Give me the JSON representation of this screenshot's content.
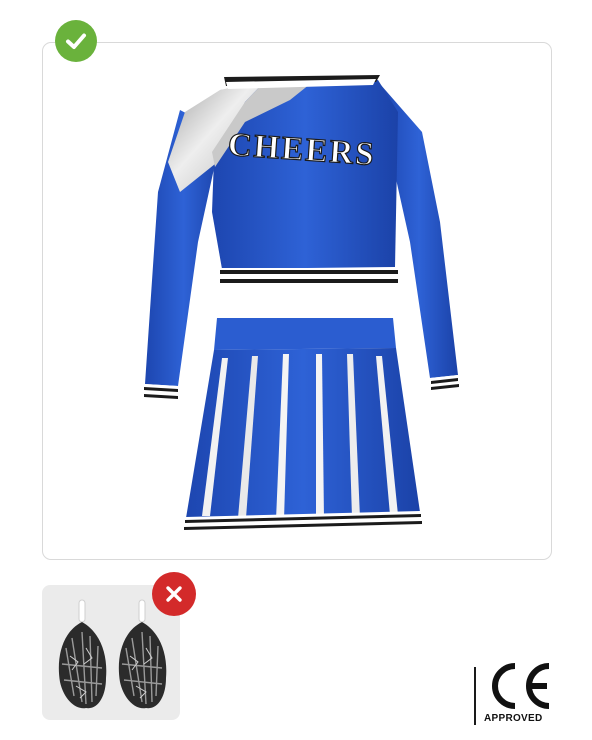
{
  "product": {
    "jersey_text": "CHEERS",
    "main_color": "#2a58c9",
    "accent_color": "#c8c8c8",
    "trim_color": "#1b1b1b"
  },
  "badges": {
    "included_icon": "checkmark-icon",
    "included_color": "#6ab23c",
    "excluded_icon": "close-icon",
    "excluded_color": "#d32a2a"
  },
  "certification": {
    "mark": "CE",
    "label": "APPROVED"
  }
}
